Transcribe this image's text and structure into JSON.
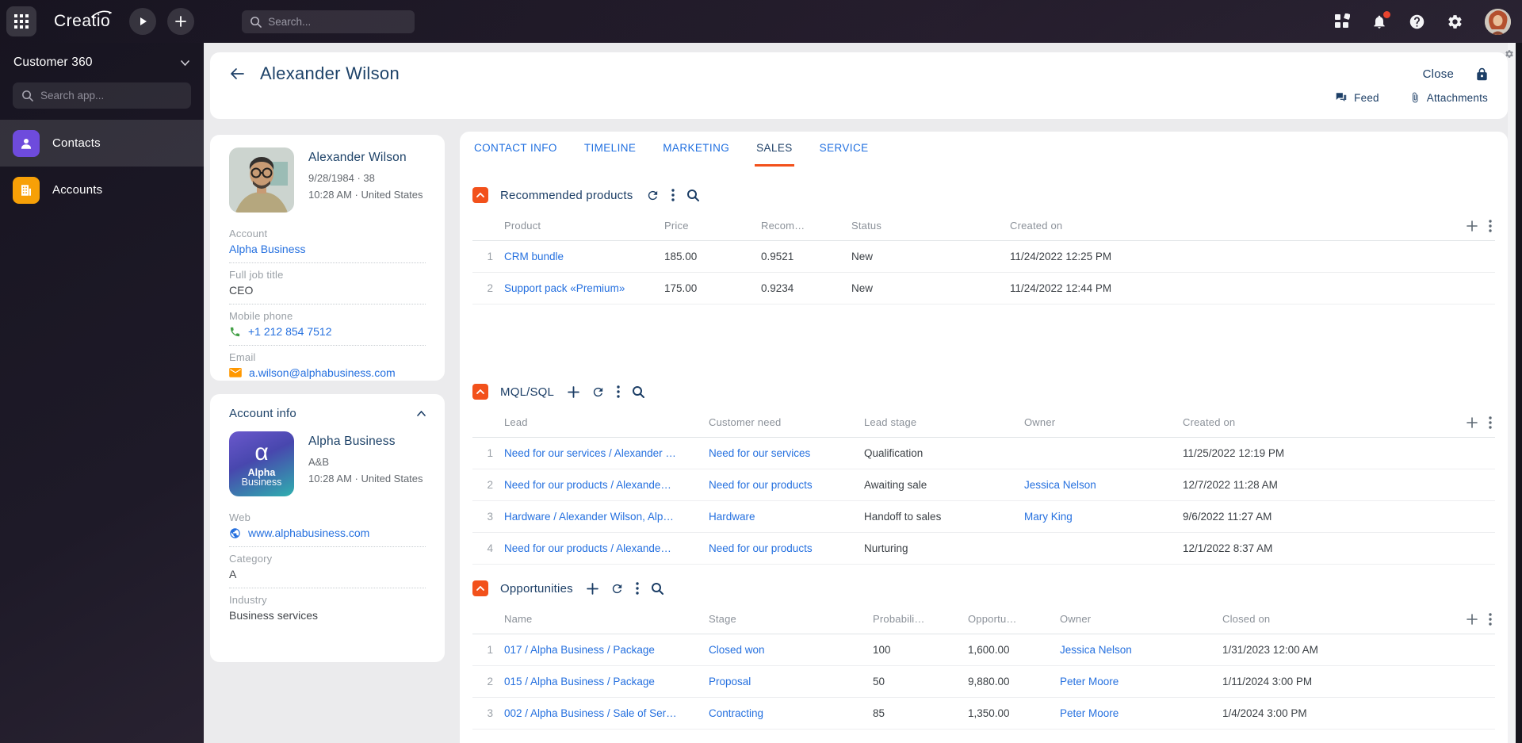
{
  "colors": {
    "accent_orange": "#F2511B",
    "link_blue": "#2570DF",
    "navy": "#1C3E66",
    "phone_green": "#43A047",
    "mail_orange": "#FF9800",
    "notification_red": "#E8442E",
    "contacts_purple": "#6E4BDC",
    "accounts_orange": "#F7A007"
  },
  "topbar": {
    "logo": "Creatio",
    "search_placeholder": "Search..."
  },
  "sidebar": {
    "workplace": "Customer 360",
    "search_placeholder": "Search app...",
    "items": [
      {
        "label": "Contacts"
      },
      {
        "label": "Accounts"
      }
    ]
  },
  "header": {
    "title": "Alexander Wilson",
    "close_label": "Close",
    "feed_label": "Feed",
    "attachments_label": "Attachments"
  },
  "contact_card": {
    "name": "Alexander Wilson",
    "birth": "9/28/1984 · 38",
    "local_time": "10:28 AM · United States",
    "fields": [
      {
        "label": "Account",
        "value": "Alpha Business"
      },
      {
        "label": "Full job title",
        "value": "CEO"
      },
      {
        "label": "Mobile phone",
        "value": "+1 212 854 7512"
      },
      {
        "label": "Email",
        "value": "a.wilson@alphabusiness.com"
      }
    ]
  },
  "account_card": {
    "title": "Account info",
    "name": "Alpha Business",
    "alias": "A&B",
    "local_time": "10:28 AM · United States",
    "logo": {
      "symbol": "α",
      "line1": "Alpha",
      "line2": "Business"
    },
    "fields": [
      {
        "label": "Web",
        "value": "www.alphabusiness.com"
      },
      {
        "label": "Category",
        "value": "A"
      },
      {
        "label": "Industry",
        "value": "Business services"
      }
    ]
  },
  "tabs": [
    {
      "label": "CONTACT INFO"
    },
    {
      "label": "TIMELINE"
    },
    {
      "label": "MARKETING"
    },
    {
      "label": "SALES"
    },
    {
      "label": "SERVICE"
    }
  ],
  "sections": {
    "recommended": {
      "title": "Recommended products",
      "columns": [
        "Product",
        "Price",
        "Recom…",
        "Status",
        "Created on"
      ],
      "rows": [
        {
          "num": "1",
          "product": "CRM bundle",
          "price": "185.00",
          "recom": "0.9521",
          "status": "New",
          "created": "11/24/2022 12:25 PM"
        },
        {
          "num": "2",
          "product": "Support pack «Premium»",
          "price": "175.00",
          "recom": "0.9234",
          "status": "New",
          "created": "11/24/2022 12:44 PM"
        }
      ]
    },
    "mql": {
      "title": "MQL/SQL",
      "columns": [
        "Lead",
        "Customer need",
        "Lead stage",
        "Owner",
        "Created on"
      ],
      "rows": [
        {
          "num": "1",
          "lead": "Need for our services / Alexander …",
          "need": "Need for our services",
          "stage": "Qualification",
          "owner": "",
          "created": "11/25/2022 12:19 PM"
        },
        {
          "num": "2",
          "lead": "Need for our products / Alexande…",
          "need": "Need for our products",
          "stage": "Awaiting sale",
          "owner": "Jessica Nelson",
          "created": "12/7/2022 11:28 AM"
        },
        {
          "num": "3",
          "lead": "Hardware / Alexander Wilson, Alp…",
          "need": "Hardware",
          "stage": "Handoff to sales",
          "owner": "Mary King",
          "created": "9/6/2022 11:27 AM"
        },
        {
          "num": "4",
          "lead": "Need for our products / Alexande…",
          "need": "Need for our products",
          "stage": "Nurturing",
          "owner": "",
          "created": "12/1/2022 8:37 AM"
        }
      ]
    },
    "opportunities": {
      "title": "Opportunities",
      "columns": [
        "Name",
        "Stage",
        "Probabili…",
        "Opportu…",
        "Owner",
        "Closed on"
      ],
      "rows": [
        {
          "num": "1",
          "name": "017 / Alpha Business / Package",
          "stage": "Closed won",
          "prob": "100",
          "opp": "1,600.00",
          "owner": "Jessica Nelson",
          "closed": "1/31/2023 12:00 AM"
        },
        {
          "num": "2",
          "name": "015 / Alpha Business / Package",
          "stage": "Proposal",
          "prob": "50",
          "opp": "9,880.00",
          "owner": "Peter Moore",
          "closed": "1/11/2024 3:00 PM"
        },
        {
          "num": "3",
          "name": "002 / Alpha Business / Sale of Ser…",
          "stage": "Contracting",
          "prob": "85",
          "opp": "1,350.00",
          "owner": "Peter Moore",
          "closed": "1/4/2024 3:00 PM"
        }
      ]
    }
  }
}
